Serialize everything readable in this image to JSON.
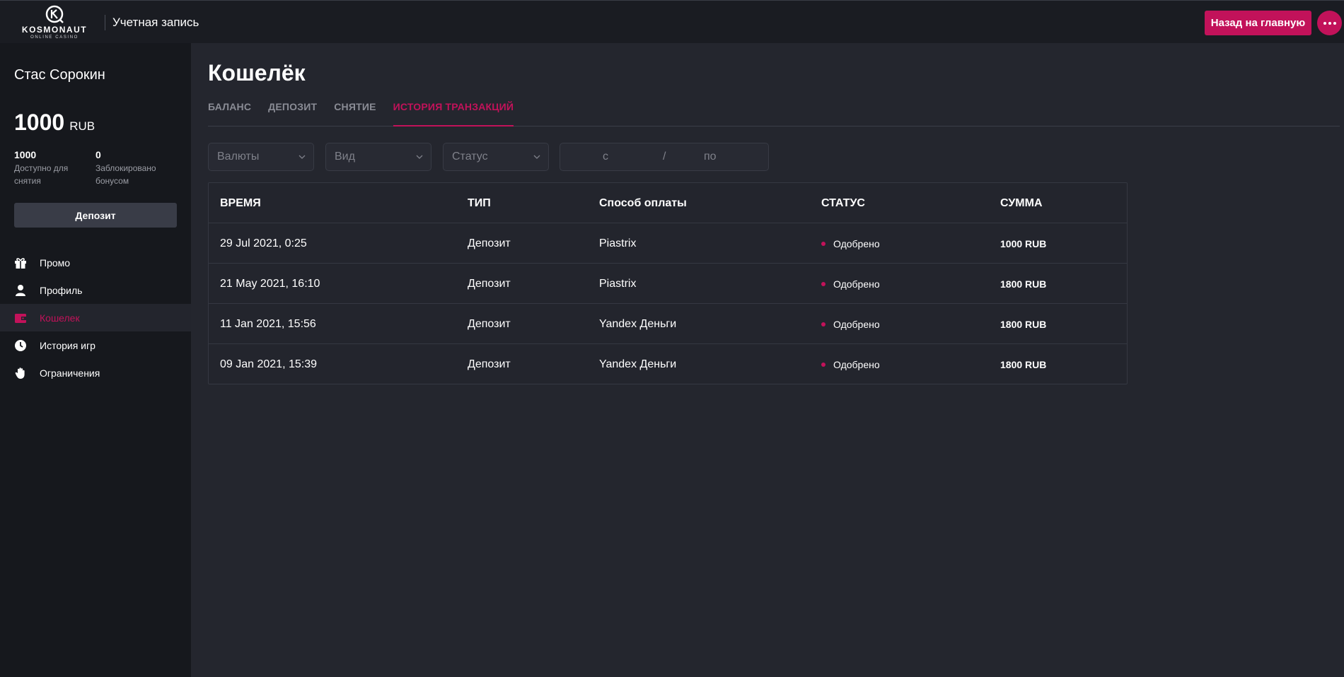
{
  "header": {
    "logo_word": "KOSMONAUT",
    "logo_sub": "ONLINE CASINO",
    "title": "Учетная запись",
    "back_button": "Назад на главную",
    "more_icon": "more-dots-icon"
  },
  "sidebar": {
    "user_name": "Стас Сорокин",
    "balance_amount": "1000",
    "balance_currency": "RUB",
    "available_value": "1000",
    "available_label": "Доступно для снятия",
    "blocked_value": "0",
    "blocked_label": "Заблокировано бонусом",
    "deposit_button": "Депозит",
    "items": [
      {
        "label": "Промо",
        "icon": "gift-icon"
      },
      {
        "label": "Профиль",
        "icon": "user-icon"
      },
      {
        "label": "Кошелек",
        "icon": "wallet-icon",
        "active": true
      },
      {
        "label": "История игр",
        "icon": "clock-icon"
      },
      {
        "label": "Ограничения",
        "icon": "hand-icon"
      }
    ]
  },
  "main": {
    "title": "Кошелёк",
    "tabs": [
      {
        "label": "БАЛАНС"
      },
      {
        "label": "ДЕПОЗИТ"
      },
      {
        "label": "СНЯТИЕ"
      },
      {
        "label": "ИСТОРИЯ ТРАНЗАКЦИЙ",
        "active": true
      }
    ],
    "filters": {
      "currency_placeholder": "Валюты",
      "type_placeholder": "Вид",
      "status_placeholder": "Статус",
      "date_from": "с",
      "date_sep": "/",
      "date_to": "по"
    },
    "table": {
      "columns": [
        "ВРЕМЯ",
        "ТИП",
        "Способ оплаты",
        "СТАТУС",
        "СУММА"
      ],
      "rows": [
        {
          "time": "29 Jul 2021, 0:25",
          "type": "Депозит",
          "method": "Piastrix",
          "status": "Одобрено",
          "amount": "1000 RUB"
        },
        {
          "time": "21 May 2021, 16:10",
          "type": "Депозит",
          "method": "Piastrix",
          "status": "Одобрено",
          "amount": "1800 RUB"
        },
        {
          "time": "11 Jan 2021, 15:56",
          "type": "Депозит",
          "method": "Yandex Деньги",
          "status": "Одобрено",
          "amount": "1800 RUB"
        },
        {
          "time": "09 Jan 2021, 15:39",
          "type": "Депозит",
          "method": "Yandex Деньги",
          "status": "Одобрено",
          "amount": "1800 RUB"
        }
      ]
    }
  },
  "colors": {
    "accent": "#c2125a",
    "sidebar_bg": "#16181d",
    "main_bg": "#24262e",
    "header_bg": "#1a1c22"
  }
}
